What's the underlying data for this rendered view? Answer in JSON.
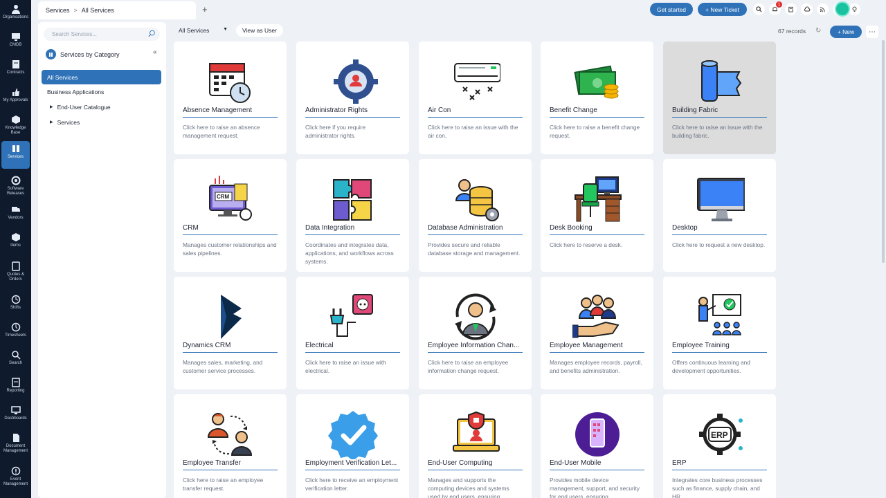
{
  "nav": [
    {
      "label": "Organisations",
      "icon": "person-icon"
    },
    {
      "label": "CMDB",
      "icon": "monitor-icon"
    },
    {
      "label": "Contracts",
      "icon": "contract-icon"
    },
    {
      "label": "My Approvals",
      "icon": "thumbs-up-icon"
    },
    {
      "label": "Knowledge Base",
      "icon": "cube-icon"
    },
    {
      "label": "Services",
      "icon": "services-icon"
    },
    {
      "label": "Software Releases",
      "icon": "release-icon"
    },
    {
      "label": "Vendors",
      "icon": "truck-icon"
    },
    {
      "label": "Items",
      "icon": "box-icon"
    },
    {
      "label": "Quotes & Orders",
      "icon": "quote-icon"
    },
    {
      "label": "Shifts",
      "icon": "clock-icon"
    },
    {
      "label": "Timesheets",
      "icon": "timer-icon"
    },
    {
      "label": "Search",
      "icon": "search-icon"
    },
    {
      "label": "Reporting",
      "icon": "report-icon"
    },
    {
      "label": "Dashboards",
      "icon": "dashboard-icon"
    },
    {
      "label": "Document Management",
      "icon": "document-icon"
    },
    {
      "label": "Event Management",
      "icon": "alert-icon"
    }
  ],
  "tab": {
    "crumb1": "Services",
    "sep": ">",
    "crumb2": "All Services",
    "plus": "+"
  },
  "top": {
    "get_started": "Get started",
    "new_ticket": "+ New Ticket",
    "notif_count": "1"
  },
  "side": {
    "search_placeholder": "Search Services...",
    "header": "Services by Category",
    "collapse": "«",
    "items": [
      {
        "label": "All Services"
      },
      {
        "label": "Business Applications"
      },
      {
        "label": "End-User Catalogue"
      },
      {
        "label": "Services"
      }
    ]
  },
  "toolbar": {
    "filter": "All Services",
    "view_as": "View as User",
    "records": "67 records",
    "new": "+ New",
    "more": "⋯"
  },
  "cards": [
    {
      "title": "Absence Management",
      "desc": "Click here to raise an absence management request.",
      "icon": "calendar-clock-icon"
    },
    {
      "title": "Administrator Rights",
      "desc": "Click here if you require administrator rights.",
      "icon": "gear-user-icon"
    },
    {
      "title": "Air Con",
      "desc": "Click here to raise an issue with the air con.",
      "icon": "air-conditioner-icon"
    },
    {
      "title": "Benefit Change",
      "desc": "Click here to raise a benefit change request.",
      "icon": "money-icon"
    },
    {
      "title": "Building Fabric",
      "desc": "Click here to raise an issue with the building fabric.",
      "icon": "fabric-roll-icon"
    },
    {
      "title": "CRM",
      "desc": "Manages customer relationships and sales pipelines.",
      "icon": "crm-monitor-icon"
    },
    {
      "title": "Data Integration",
      "desc": "Coordinates and integrates data, applications, and workflows across systems.",
      "icon": "puzzle-icon"
    },
    {
      "title": "Database Administration",
      "desc": "Provides secure and reliable database storage and management.",
      "icon": "database-gear-icon"
    },
    {
      "title": "Desk Booking",
      "desc": "Click here to reserve a desk.",
      "icon": "desk-icon"
    },
    {
      "title": "Desktop",
      "desc": "Click here to request a new desktop.",
      "icon": "desktop-icon"
    },
    {
      "title": "Dynamics CRM",
      "desc": "Manages sales, marketing, and customer service processes.",
      "icon": "dynamics-logo-icon"
    },
    {
      "title": "Electrical",
      "desc": "Click here to raise an issue with electrical.",
      "icon": "plug-icon"
    },
    {
      "title": "Employee Information Chan...",
      "desc": "Click here to raise an employee information change request.",
      "icon": "employee-cycle-icon"
    },
    {
      "title": "Employee Management",
      "desc": "Manages employee records, payroll, and benefits administration.",
      "icon": "team-hand-icon"
    },
    {
      "title": "Employee Training",
      "desc": "Offers continuous learning and development opportunities.",
      "icon": "training-board-icon"
    },
    {
      "title": "Employee Transfer",
      "desc": "Click here to raise an employee transfer request.",
      "icon": "transfer-people-icon"
    },
    {
      "title": "Employment Verification Let...",
      "desc": "Click here to receive an employment verification letter.",
      "icon": "verified-badge-icon"
    },
    {
      "title": "End-User Computing",
      "desc": "Manages and supports the computing devices and systems used by end users, ensuring",
      "icon": "laptop-shield-icon"
    },
    {
      "title": "End-User Mobile",
      "desc": "Provides mobile device management, support, and security for end users, ensuring",
      "icon": "mobile-icon"
    },
    {
      "title": "ERP",
      "desc": "Integrates core business processes such as finance, supply chain, and HR",
      "icon": "erp-gear-icon"
    }
  ]
}
